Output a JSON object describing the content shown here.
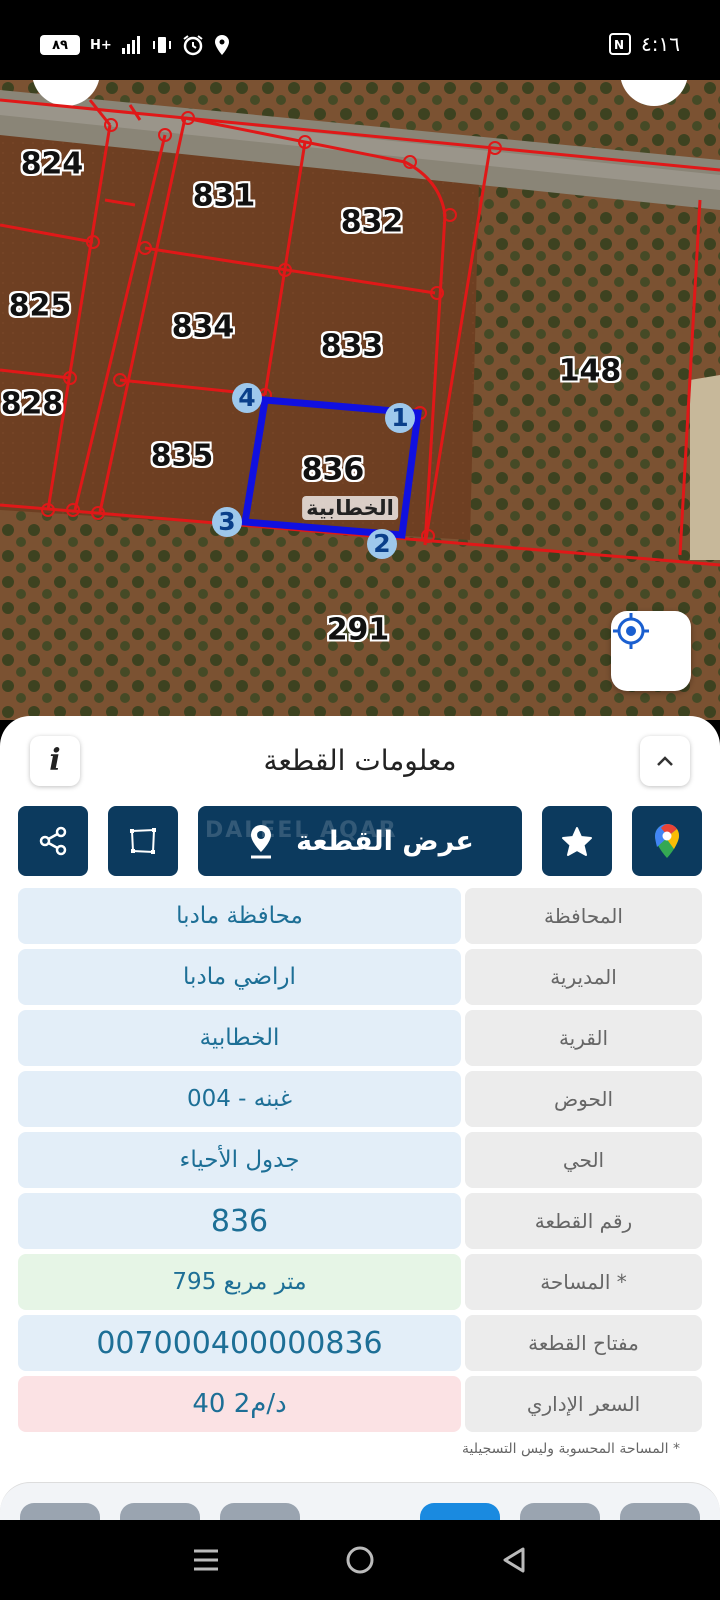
{
  "status_bar": {
    "battery": "٨٩",
    "network": "H+",
    "time": "٤:١٦"
  },
  "map": {
    "parcels": [
      "824",
      "831",
      "832",
      "825",
      "834",
      "833",
      "148",
      "828",
      "835",
      "836",
      "291"
    ],
    "village_label": "الخطابية",
    "vertices": [
      "1",
      "2",
      "3",
      "4"
    ]
  },
  "sheet": {
    "title": "معلومات القطعة",
    "info_icon": "i",
    "show_parcel_label": "عرض القطعة",
    "watermark": "DALEEL AQAR",
    "rows": [
      {
        "label": "المحافظة",
        "value": "محافظة مادبا"
      },
      {
        "label": "المديرية",
        "value": "اراضي مادبا"
      },
      {
        "label": "القرية",
        "value": "الخطابية"
      },
      {
        "label": "الحوض",
        "value": "غبنه - 004"
      },
      {
        "label": "الحي",
        "value": "جدول الأحياء"
      },
      {
        "label": "رقم القطعة",
        "value": "836"
      },
      {
        "label": "المساحة *",
        "value": "795  متر مربع"
      },
      {
        "label": "مفتاح القطعة",
        "value": "007000400000836"
      },
      {
        "label": "السعر الإداري",
        "value": "40 د/م2"
      }
    ],
    "footnote": "* المساحة المحسوبة وليس التسجيلية"
  },
  "icons": {
    "share": "share-icon",
    "area": "polygon-icon",
    "location": "map-pin-icon",
    "favorite": "star-icon",
    "google_maps": "google-maps-icon",
    "collapse": "chevron-up-icon",
    "locate": "gps-target-icon"
  },
  "colors": {
    "primary": "#0c3a5e",
    "parcel_outline": "#1010e0",
    "boundary": "#e01818",
    "value_text": "#1d6f96"
  }
}
